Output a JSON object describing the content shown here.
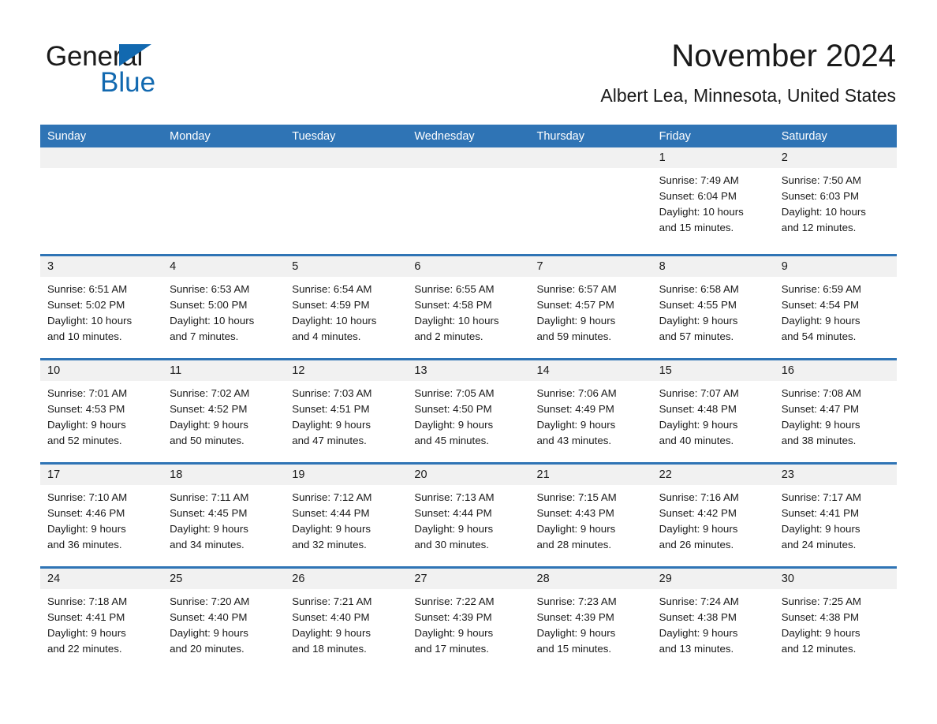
{
  "brand": {
    "name_top": "General",
    "name_bottom": "Blue",
    "accent_color": "#1269b0"
  },
  "header": {
    "title": "November 2024",
    "subtitle": "Albert Lea, Minnesota, United States"
  },
  "theme": {
    "header_blue": "#2f74b5",
    "day_band_gray": "#f1f1f1",
    "text_color": "#1a1a1a"
  },
  "weekdays": [
    "Sunday",
    "Monday",
    "Tuesday",
    "Wednesday",
    "Thursday",
    "Friday",
    "Saturday"
  ],
  "labels": {
    "sunrise_prefix": "Sunrise:",
    "sunset_prefix": "Sunset:",
    "daylight_prefix": "Daylight:"
  },
  "weeks": [
    [
      {
        "day": "",
        "empty": true,
        "line1": "",
        "line2": "",
        "line3": "",
        "line4": ""
      },
      {
        "day": "",
        "empty": true,
        "line1": "",
        "line2": "",
        "line3": "",
        "line4": ""
      },
      {
        "day": "",
        "empty": true,
        "line1": "",
        "line2": "",
        "line3": "",
        "line4": ""
      },
      {
        "day": "",
        "empty": true,
        "line1": "",
        "line2": "",
        "line3": "",
        "line4": ""
      },
      {
        "day": "",
        "empty": true,
        "line1": "",
        "line2": "",
        "line3": "",
        "line4": ""
      },
      {
        "day": "1",
        "empty": false,
        "line1": "Sunrise: 7:49 AM",
        "line2": "Sunset: 6:04 PM",
        "line3": "Daylight: 10 hours",
        "line4": "and 15 minutes."
      },
      {
        "day": "2",
        "empty": false,
        "line1": "Sunrise: 7:50 AM",
        "line2": "Sunset: 6:03 PM",
        "line3": "Daylight: 10 hours",
        "line4": "and 12 minutes."
      }
    ],
    [
      {
        "day": "3",
        "empty": false,
        "line1": "Sunrise: 6:51 AM",
        "line2": "Sunset: 5:02 PM",
        "line3": "Daylight: 10 hours",
        "line4": "and 10 minutes."
      },
      {
        "day": "4",
        "empty": false,
        "line1": "Sunrise: 6:53 AM",
        "line2": "Sunset: 5:00 PM",
        "line3": "Daylight: 10 hours",
        "line4": "and 7 minutes."
      },
      {
        "day": "5",
        "empty": false,
        "line1": "Sunrise: 6:54 AM",
        "line2": "Sunset: 4:59 PM",
        "line3": "Daylight: 10 hours",
        "line4": "and 4 minutes."
      },
      {
        "day": "6",
        "empty": false,
        "line1": "Sunrise: 6:55 AM",
        "line2": "Sunset: 4:58 PM",
        "line3": "Daylight: 10 hours",
        "line4": "and 2 minutes."
      },
      {
        "day": "7",
        "empty": false,
        "line1": "Sunrise: 6:57 AM",
        "line2": "Sunset: 4:57 PM",
        "line3": "Daylight: 9 hours",
        "line4": "and 59 minutes."
      },
      {
        "day": "8",
        "empty": false,
        "line1": "Sunrise: 6:58 AM",
        "line2": "Sunset: 4:55 PM",
        "line3": "Daylight: 9 hours",
        "line4": "and 57 minutes."
      },
      {
        "day": "9",
        "empty": false,
        "line1": "Sunrise: 6:59 AM",
        "line2": "Sunset: 4:54 PM",
        "line3": "Daylight: 9 hours",
        "line4": "and 54 minutes."
      }
    ],
    [
      {
        "day": "10",
        "empty": false,
        "line1": "Sunrise: 7:01 AM",
        "line2": "Sunset: 4:53 PM",
        "line3": "Daylight: 9 hours",
        "line4": "and 52 minutes."
      },
      {
        "day": "11",
        "empty": false,
        "line1": "Sunrise: 7:02 AM",
        "line2": "Sunset: 4:52 PM",
        "line3": "Daylight: 9 hours",
        "line4": "and 50 minutes."
      },
      {
        "day": "12",
        "empty": false,
        "line1": "Sunrise: 7:03 AM",
        "line2": "Sunset: 4:51 PM",
        "line3": "Daylight: 9 hours",
        "line4": "and 47 minutes."
      },
      {
        "day": "13",
        "empty": false,
        "line1": "Sunrise: 7:05 AM",
        "line2": "Sunset: 4:50 PM",
        "line3": "Daylight: 9 hours",
        "line4": "and 45 minutes."
      },
      {
        "day": "14",
        "empty": false,
        "line1": "Sunrise: 7:06 AM",
        "line2": "Sunset: 4:49 PM",
        "line3": "Daylight: 9 hours",
        "line4": "and 43 minutes."
      },
      {
        "day": "15",
        "empty": false,
        "line1": "Sunrise: 7:07 AM",
        "line2": "Sunset: 4:48 PM",
        "line3": "Daylight: 9 hours",
        "line4": "and 40 minutes."
      },
      {
        "day": "16",
        "empty": false,
        "line1": "Sunrise: 7:08 AM",
        "line2": "Sunset: 4:47 PM",
        "line3": "Daylight: 9 hours",
        "line4": "and 38 minutes."
      }
    ],
    [
      {
        "day": "17",
        "empty": false,
        "line1": "Sunrise: 7:10 AM",
        "line2": "Sunset: 4:46 PM",
        "line3": "Daylight: 9 hours",
        "line4": "and 36 minutes."
      },
      {
        "day": "18",
        "empty": false,
        "line1": "Sunrise: 7:11 AM",
        "line2": "Sunset: 4:45 PM",
        "line3": "Daylight: 9 hours",
        "line4": "and 34 minutes."
      },
      {
        "day": "19",
        "empty": false,
        "line1": "Sunrise: 7:12 AM",
        "line2": "Sunset: 4:44 PM",
        "line3": "Daylight: 9 hours",
        "line4": "and 32 minutes."
      },
      {
        "day": "20",
        "empty": false,
        "line1": "Sunrise: 7:13 AM",
        "line2": "Sunset: 4:44 PM",
        "line3": "Daylight: 9 hours",
        "line4": "and 30 minutes."
      },
      {
        "day": "21",
        "empty": false,
        "line1": "Sunrise: 7:15 AM",
        "line2": "Sunset: 4:43 PM",
        "line3": "Daylight: 9 hours",
        "line4": "and 28 minutes."
      },
      {
        "day": "22",
        "empty": false,
        "line1": "Sunrise: 7:16 AM",
        "line2": "Sunset: 4:42 PM",
        "line3": "Daylight: 9 hours",
        "line4": "and 26 minutes."
      },
      {
        "day": "23",
        "empty": false,
        "line1": "Sunrise: 7:17 AM",
        "line2": "Sunset: 4:41 PM",
        "line3": "Daylight: 9 hours",
        "line4": "and 24 minutes."
      }
    ],
    [
      {
        "day": "24",
        "empty": false,
        "line1": "Sunrise: 7:18 AM",
        "line2": "Sunset: 4:41 PM",
        "line3": "Daylight: 9 hours",
        "line4": "and 22 minutes."
      },
      {
        "day": "25",
        "empty": false,
        "line1": "Sunrise: 7:20 AM",
        "line2": "Sunset: 4:40 PM",
        "line3": "Daylight: 9 hours",
        "line4": "and 20 minutes."
      },
      {
        "day": "26",
        "empty": false,
        "line1": "Sunrise: 7:21 AM",
        "line2": "Sunset: 4:40 PM",
        "line3": "Daylight: 9 hours",
        "line4": "and 18 minutes."
      },
      {
        "day": "27",
        "empty": false,
        "line1": "Sunrise: 7:22 AM",
        "line2": "Sunset: 4:39 PM",
        "line3": "Daylight: 9 hours",
        "line4": "and 17 minutes."
      },
      {
        "day": "28",
        "empty": false,
        "line1": "Sunrise: 7:23 AM",
        "line2": "Sunset: 4:39 PM",
        "line3": "Daylight: 9 hours",
        "line4": "and 15 minutes."
      },
      {
        "day": "29",
        "empty": false,
        "line1": "Sunrise: 7:24 AM",
        "line2": "Sunset: 4:38 PM",
        "line3": "Daylight: 9 hours",
        "line4": "and 13 minutes."
      },
      {
        "day": "30",
        "empty": false,
        "line1": "Sunrise: 7:25 AM",
        "line2": "Sunset: 4:38 PM",
        "line3": "Daylight: 9 hours",
        "line4": "and 12 minutes."
      }
    ]
  ]
}
